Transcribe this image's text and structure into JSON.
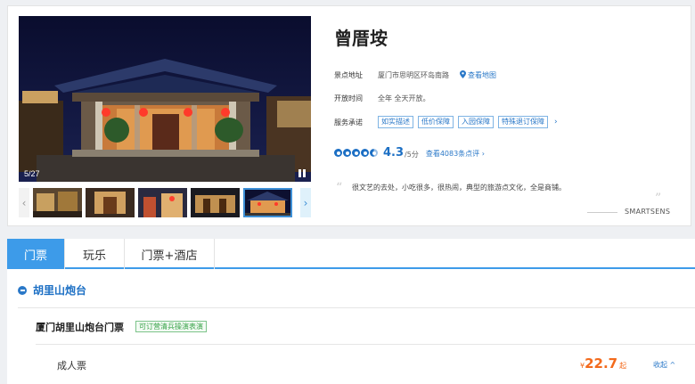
{
  "attraction": {
    "title": "曾厝垵",
    "photo_counter": "5/27",
    "address_label": "景点地址",
    "address_value": "厦门市思明区环岛南路",
    "map_link": "查看地图",
    "hours_label": "开放时间",
    "hours_value": "全年 全天开放。",
    "service_label": "服务承诺",
    "service_tags": [
      "如实描述",
      "低价保障",
      "入园保障",
      "特殊退订保障"
    ],
    "rating_score": "4.3",
    "rating_max": "/5分",
    "review_link": "查看4083条点评",
    "quote_text": "很文艺的去处，小吃很多，很热闹，典型的旅游点文化，全是商铺。",
    "quote_author": "SMARTSENS"
  },
  "tabs": [
    "门票",
    "玩乐",
    "门票+酒店"
  ],
  "section": {
    "title": "胡里山炮台",
    "product_title": "厦门胡里山炮台门票",
    "product_badge": "可订营清兵操演表演",
    "ticket_name": "成人票",
    "price_currency": "¥",
    "price_value": "22.7",
    "price_suffix": "起",
    "collapse_link": "收起 ^"
  },
  "colors": {
    "accent": "#3d9be9",
    "link": "#2a78c8",
    "price": "#f36a1c",
    "badge_green": "#3aa34a"
  },
  "icons": {
    "map_pin": "map-pin-icon",
    "pause": "pause-icon",
    "section": "ticket-section-icon",
    "prev": "chevron-left-icon",
    "next": "chevron-right-icon"
  }
}
